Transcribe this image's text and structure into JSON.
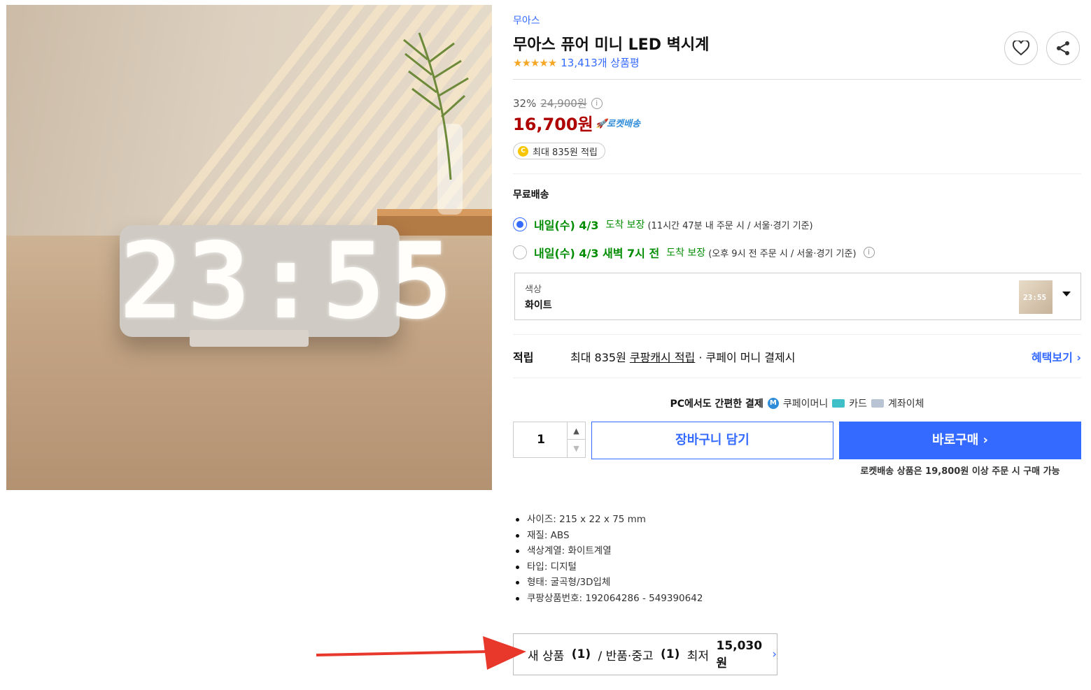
{
  "product": {
    "brand": "무아스",
    "title": "무아스 퓨어 미니 LED 벽시계",
    "rating_stars": "★★★★★",
    "review_count": "13,413개 상품평",
    "image_clock_text": "23:55"
  },
  "actions": {
    "wishlist_icon": "heart-icon",
    "share_icon": "share-icon"
  },
  "pricing": {
    "discount": "32%",
    "original_price": "24,900원",
    "info_glyph": "i",
    "price": "16,700원",
    "rocket_label": "🚀로켓배송",
    "cash_coin": "C",
    "cash_badge": "최대 835원 적립",
    "accent": "#ae0000"
  },
  "shipping": {
    "label": "무료배송",
    "options": [
      {
        "selected": true,
        "date": "내일(수) 4/3",
        "arrive": "도착 보장",
        "note": "(11시간 47분 내 주문 시 / 서울·경기 기준)"
      },
      {
        "selected": false,
        "date": "내일(수) 4/3 새벽 7시 전",
        "arrive": "도착 보장",
        "note": "(오후 9시 전 주문 시 / 서울·경기 기준)"
      }
    ]
  },
  "option_select": {
    "label": "색상",
    "value": "화이트",
    "thumb_text": "23:55"
  },
  "earn": {
    "key": "적립",
    "prefix": "최대 835원 ",
    "link_text": "쿠팡캐시 적립",
    "suffix": " · 쿠페이 머니 결제시",
    "benefit_link": "혜택보기 ›"
  },
  "payment": {
    "lead": "PC에서도 간편한 결제",
    "m_glyph": "M",
    "money": "쿠페이머니",
    "card": "카드",
    "bank": "계좌이체"
  },
  "purchase": {
    "quantity": "1",
    "up_glyph": "▲",
    "down_glyph": "▼",
    "cart_label": "장바구니 담기",
    "buy_label": "바로구매 ›",
    "note": "로켓배송 상품은 19,800원 이상 주문 시 구매 가능",
    "brand_color": "#346aff"
  },
  "specs": [
    "사이즈: 215 x 22 x 75 mm",
    "재질: ABS",
    "색상계열: 화이트계열",
    "타입: 디지털",
    "형태: 굴곡형/3D입체",
    "쿠팡상품번호: 192064286 - 549390642"
  ],
  "other_offers": {
    "a": "새 상품 ",
    "a_count": "(1)",
    "b": " / 반품·중고 ",
    "b_count": "(1)",
    "c": " 최저 ",
    "price": "15,030원",
    "chev": "›"
  },
  "annotation": {
    "arrow_color": "#e8382b"
  }
}
